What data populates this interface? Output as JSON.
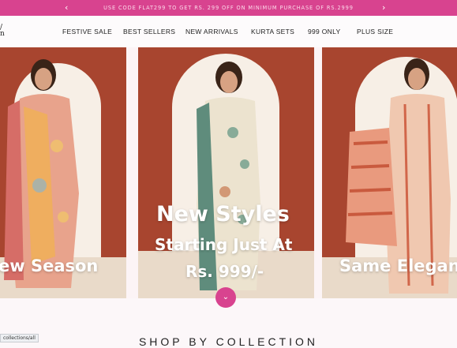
{
  "promo": {
    "text": "USE CODE FLAT299 TO GET RS. 299 OFF ON MINIMUM PURCHASE OF RS.2999",
    "prev_icon": "chevron-left-icon",
    "next_icon": "chevron-right-icon"
  },
  "logo": {
    "fragment_line1": "/",
    "fragment_line2": "n"
  },
  "nav": {
    "items": [
      "FESTIVE SALE",
      "BEST SELLERS",
      "NEW ARRIVALS",
      "KURTA SETS",
      "999 ONLY",
      "PLUS SIZE"
    ]
  },
  "hero": {
    "left_fragment": "y",
    "left_fragment2": "n",
    "slides": [
      {
        "caption": "ew Season"
      },
      {
        "headline": "New Styles",
        "subline": "Starting Just At",
        "price": "Rs. 999/-"
      },
      {
        "caption": "Same Elegan"
      }
    ],
    "scroll_icon": "chevron-down-icon"
  },
  "section": {
    "title": "SHOP BY COLLECTION"
  },
  "status_link": {
    "text": "collections/all"
  },
  "colors": {
    "brand": "#d8438f",
    "wall": "#a8452f"
  }
}
